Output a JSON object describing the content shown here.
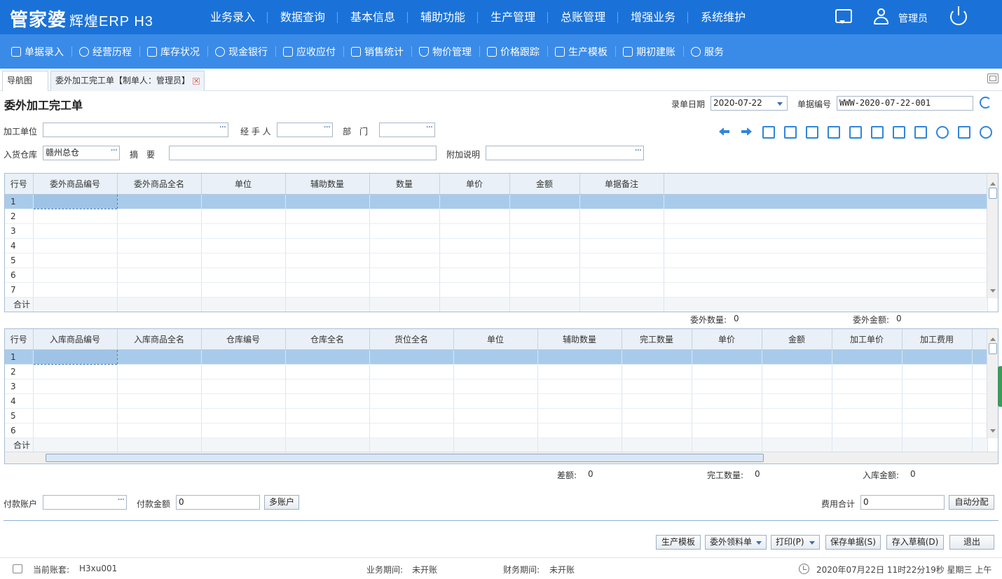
{
  "app": {
    "logo_main": "管家婆",
    "logo_sub": "辉煌ERP H3"
  },
  "main_menu": [
    "业务录入",
    "数据查询",
    "基本信息",
    "辅助功能",
    "生产管理",
    "总账管理",
    "增强业务",
    "系统维护"
  ],
  "user": {
    "name": "管理员"
  },
  "sub_menu": [
    "单据录入",
    "经营历程",
    "库存状况",
    "现金银行",
    "应收应付",
    "销售统计",
    "物价管理",
    "价格跟踪",
    "生产模板",
    "期初建账",
    "服务"
  ],
  "tabs": {
    "nav": "导航图",
    "doc": "委外加工完工单【制单人：管理员】",
    "close": "✕"
  },
  "form": {
    "title": "委外加工完工单",
    "date_label": "录单日期",
    "date_value": "2020-07-22",
    "no_label": "单据编号",
    "no_value": "WWW-2020-07-22-001",
    "unit_label": "加工单位",
    "unit_value": "",
    "handler_label": "经 手 人",
    "handler_value": "",
    "dept_label": "部　门",
    "dept_value": "",
    "warehouse_label": "入货仓库",
    "warehouse_value": "赣州总仓",
    "summary_label": "摘　要",
    "summary_value": "",
    "note_label": "附加说明",
    "note_value": "",
    "dots": "···"
  },
  "grid1": {
    "headers": [
      "行号",
      "委外商品编号",
      "委外商品全名",
      "单位",
      "辅助数量",
      "数量",
      "单价",
      "金额",
      "单据备注",
      ""
    ],
    "rows": [
      "1",
      "2",
      "3",
      "4",
      "5",
      "6",
      "7"
    ],
    "total": "合计"
  },
  "grid1_summary": {
    "qty_label": "委外数量:",
    "qty_value": "0",
    "amount_label": "委外金额:",
    "amount_value": "0"
  },
  "grid2": {
    "headers": [
      "行号",
      "入库商品编号",
      "入库商品全名",
      "仓库编号",
      "仓库全名",
      "货位全名",
      "单位",
      "辅助数量",
      "完工数量",
      "单价",
      "金额",
      "加工单价",
      "加工费用",
      ""
    ],
    "rows": [
      "1",
      "2",
      "3",
      "4",
      "5",
      "6"
    ],
    "total": "合计"
  },
  "grid2_summary": {
    "diff_label": "差额:",
    "diff_value": "0",
    "done_label": "完工数量:",
    "done_value": "0",
    "in_label": "入库金额:",
    "in_value": "0"
  },
  "payment": {
    "account_label": "付款账户",
    "account_value": "",
    "amount_label": "付款金额",
    "amount_value": "0",
    "multi_btn": "多账户",
    "fee_label": "费用合计",
    "fee_value": "0",
    "auto_btn": "自动分配"
  },
  "actions": {
    "template": "生产模板",
    "material": "委外领料单",
    "print": "打印(P)",
    "save": "保存单据(S)",
    "draft": "存入草稿(D)",
    "exit": "退出"
  },
  "status": {
    "account_label": "当前账套:",
    "account_value": "H3xu001",
    "biz_label": "业务期间:",
    "biz_value": "未开账",
    "fin_label": "财务期间:",
    "fin_value": "未开账",
    "datetime": "2020年07月22日 11时22分19秒 星期三 上午"
  },
  "colors": {
    "topbar": "#1a72d8",
    "subbar": "#3a8be8",
    "icon": "#2f86d8",
    "selected_row": "#a9cbeb"
  },
  "toolbar_icons": [
    "arrow-left-icon",
    "arrow-right-icon",
    "barcode-icon",
    "stamp-icon",
    "settings-doc-icon",
    "copy-icon",
    "import-icon",
    "number-icon",
    "save-icon",
    "export-icon",
    "person-icon",
    "folder-icon",
    "help-icon"
  ]
}
